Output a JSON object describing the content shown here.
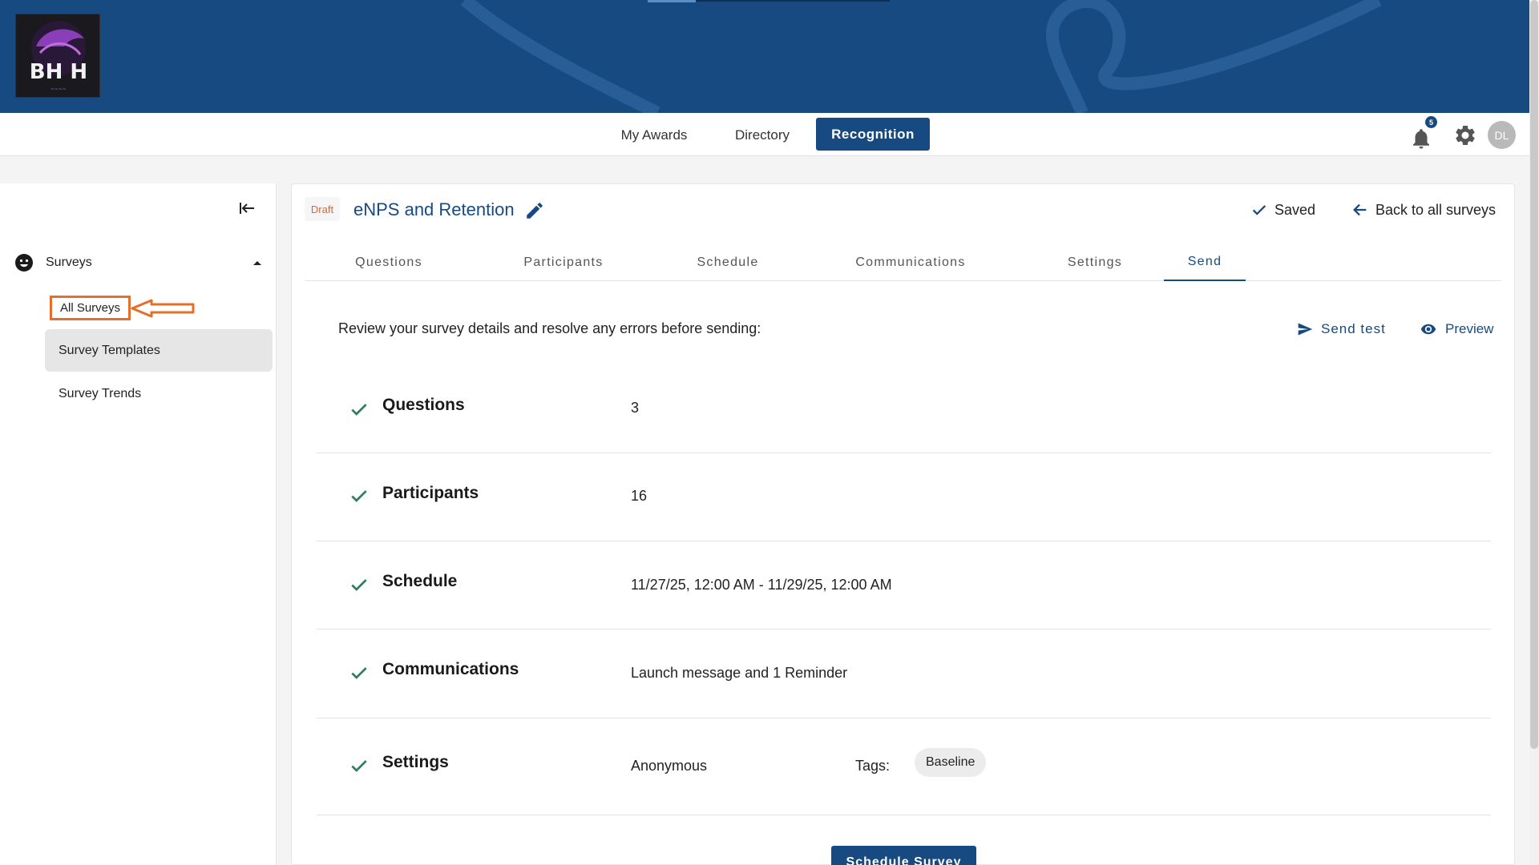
{
  "banner": {
    "logo_text": "BH H"
  },
  "topnav": {
    "links": [
      {
        "label": "My Awards"
      },
      {
        "label": "Directory"
      },
      {
        "label": "Recognition",
        "active": true
      }
    ],
    "notification_count": "5",
    "avatar_initials": "DL"
  },
  "sidebar": {
    "section_label": "Surveys",
    "items": [
      {
        "label": "All Surveys"
      },
      {
        "label": "Survey Templates"
      },
      {
        "label": "Survey Trends"
      }
    ]
  },
  "header": {
    "status_badge": "Draft",
    "title": "eNPS and Retention",
    "saved_label": "Saved",
    "back_label": "Back to all surveys"
  },
  "tabs": [
    {
      "label": "Questions"
    },
    {
      "label": "Participants"
    },
    {
      "label": "Schedule"
    },
    {
      "label": "Communications"
    },
    {
      "label": "Settings"
    },
    {
      "label": "Send",
      "active": true
    }
  ],
  "review": {
    "instruction": "Review your survey details and resolve any errors before sending:",
    "send_test_label": "Send test",
    "preview_label": "Preview"
  },
  "summary": [
    {
      "label": "Questions",
      "value": "3"
    },
    {
      "label": "Participants",
      "value": "16"
    },
    {
      "label": "Schedule",
      "value": "11/27/25, 12:00 AM - 11/29/25, 12:00 AM"
    },
    {
      "label": "Communications",
      "value": "Launch message and 1 Reminder"
    },
    {
      "label": "Settings",
      "value": "Anonymous",
      "tags_label": "Tags:",
      "tags": [
        "Baseline"
      ]
    }
  ],
  "actions": {
    "schedule_label": "Schedule Survey"
  },
  "colors": {
    "brand": "#164a80",
    "annotation": "#e46f2a",
    "check": "#2e7d5b"
  }
}
